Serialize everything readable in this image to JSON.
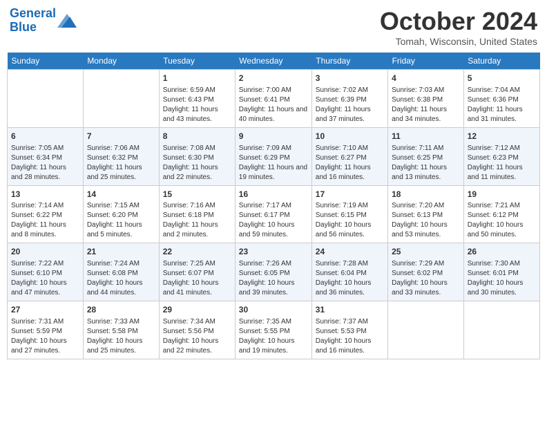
{
  "header": {
    "logo_line1": "General",
    "logo_line2": "Blue",
    "month": "October 2024",
    "location": "Tomah, Wisconsin, United States"
  },
  "weekdays": [
    "Sunday",
    "Monday",
    "Tuesday",
    "Wednesday",
    "Thursday",
    "Friday",
    "Saturday"
  ],
  "weeks": [
    [
      {
        "day": "",
        "text": ""
      },
      {
        "day": "",
        "text": ""
      },
      {
        "day": "1",
        "text": "Sunrise: 6:59 AM\nSunset: 6:43 PM\nDaylight: 11 hours and 43 minutes."
      },
      {
        "day": "2",
        "text": "Sunrise: 7:00 AM\nSunset: 6:41 PM\nDaylight: 11 hours and 40 minutes."
      },
      {
        "day": "3",
        "text": "Sunrise: 7:02 AM\nSunset: 6:39 PM\nDaylight: 11 hours and 37 minutes."
      },
      {
        "day": "4",
        "text": "Sunrise: 7:03 AM\nSunset: 6:38 PM\nDaylight: 11 hours and 34 minutes."
      },
      {
        "day": "5",
        "text": "Sunrise: 7:04 AM\nSunset: 6:36 PM\nDaylight: 11 hours and 31 minutes."
      }
    ],
    [
      {
        "day": "6",
        "text": "Sunrise: 7:05 AM\nSunset: 6:34 PM\nDaylight: 11 hours and 28 minutes."
      },
      {
        "day": "7",
        "text": "Sunrise: 7:06 AM\nSunset: 6:32 PM\nDaylight: 11 hours and 25 minutes."
      },
      {
        "day": "8",
        "text": "Sunrise: 7:08 AM\nSunset: 6:30 PM\nDaylight: 11 hours and 22 minutes."
      },
      {
        "day": "9",
        "text": "Sunrise: 7:09 AM\nSunset: 6:29 PM\nDaylight: 11 hours and 19 minutes."
      },
      {
        "day": "10",
        "text": "Sunrise: 7:10 AM\nSunset: 6:27 PM\nDaylight: 11 hours and 16 minutes."
      },
      {
        "day": "11",
        "text": "Sunrise: 7:11 AM\nSunset: 6:25 PM\nDaylight: 11 hours and 13 minutes."
      },
      {
        "day": "12",
        "text": "Sunrise: 7:12 AM\nSunset: 6:23 PM\nDaylight: 11 hours and 11 minutes."
      }
    ],
    [
      {
        "day": "13",
        "text": "Sunrise: 7:14 AM\nSunset: 6:22 PM\nDaylight: 11 hours and 8 minutes."
      },
      {
        "day": "14",
        "text": "Sunrise: 7:15 AM\nSunset: 6:20 PM\nDaylight: 11 hours and 5 minutes."
      },
      {
        "day": "15",
        "text": "Sunrise: 7:16 AM\nSunset: 6:18 PM\nDaylight: 11 hours and 2 minutes."
      },
      {
        "day": "16",
        "text": "Sunrise: 7:17 AM\nSunset: 6:17 PM\nDaylight: 10 hours and 59 minutes."
      },
      {
        "day": "17",
        "text": "Sunrise: 7:19 AM\nSunset: 6:15 PM\nDaylight: 10 hours and 56 minutes."
      },
      {
        "day": "18",
        "text": "Sunrise: 7:20 AM\nSunset: 6:13 PM\nDaylight: 10 hours and 53 minutes."
      },
      {
        "day": "19",
        "text": "Sunrise: 7:21 AM\nSunset: 6:12 PM\nDaylight: 10 hours and 50 minutes."
      }
    ],
    [
      {
        "day": "20",
        "text": "Sunrise: 7:22 AM\nSunset: 6:10 PM\nDaylight: 10 hours and 47 minutes."
      },
      {
        "day": "21",
        "text": "Sunrise: 7:24 AM\nSunset: 6:08 PM\nDaylight: 10 hours and 44 minutes."
      },
      {
        "day": "22",
        "text": "Sunrise: 7:25 AM\nSunset: 6:07 PM\nDaylight: 10 hours and 41 minutes."
      },
      {
        "day": "23",
        "text": "Sunrise: 7:26 AM\nSunset: 6:05 PM\nDaylight: 10 hours and 39 minutes."
      },
      {
        "day": "24",
        "text": "Sunrise: 7:28 AM\nSunset: 6:04 PM\nDaylight: 10 hours and 36 minutes."
      },
      {
        "day": "25",
        "text": "Sunrise: 7:29 AM\nSunset: 6:02 PM\nDaylight: 10 hours and 33 minutes."
      },
      {
        "day": "26",
        "text": "Sunrise: 7:30 AM\nSunset: 6:01 PM\nDaylight: 10 hours and 30 minutes."
      }
    ],
    [
      {
        "day": "27",
        "text": "Sunrise: 7:31 AM\nSunset: 5:59 PM\nDaylight: 10 hours and 27 minutes."
      },
      {
        "day": "28",
        "text": "Sunrise: 7:33 AM\nSunset: 5:58 PM\nDaylight: 10 hours and 25 minutes."
      },
      {
        "day": "29",
        "text": "Sunrise: 7:34 AM\nSunset: 5:56 PM\nDaylight: 10 hours and 22 minutes."
      },
      {
        "day": "30",
        "text": "Sunrise: 7:35 AM\nSunset: 5:55 PM\nDaylight: 10 hours and 19 minutes."
      },
      {
        "day": "31",
        "text": "Sunrise: 7:37 AM\nSunset: 5:53 PM\nDaylight: 10 hours and 16 minutes."
      },
      {
        "day": "",
        "text": ""
      },
      {
        "day": "",
        "text": ""
      }
    ]
  ]
}
